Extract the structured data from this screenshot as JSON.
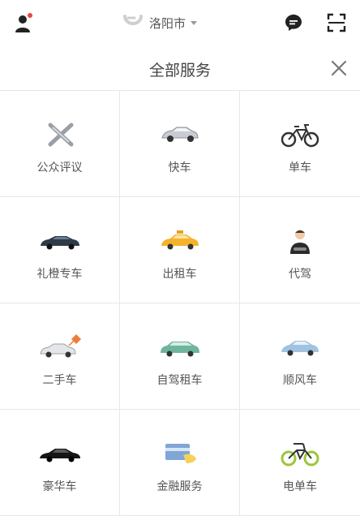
{
  "top_bar": {
    "city": "洛阳市",
    "icons": [
      "user-icon",
      "didi-logo-icon",
      "chat-icon",
      "scan-icon"
    ],
    "notification_color": "#e8473b"
  },
  "header": {
    "title": "全部服务",
    "close_icon": "close-icon"
  },
  "services": [
    {
      "label": "公众评议",
      "icon": "review-icon"
    },
    {
      "label": "快车",
      "icon": "car-icon"
    },
    {
      "label": "单车",
      "icon": "bicycle-icon"
    },
    {
      "label": "礼橙专车",
      "icon": "premier-car-icon"
    },
    {
      "label": "出租车",
      "icon": "taxi-icon"
    },
    {
      "label": "代驾",
      "icon": "driver-icon"
    },
    {
      "label": "二手车",
      "icon": "used-car-icon"
    },
    {
      "label": "自驾租车",
      "icon": "rental-car-icon"
    },
    {
      "label": "顺风车",
      "icon": "carpool-car-icon"
    },
    {
      "label": "豪华车",
      "icon": "luxury-car-icon"
    },
    {
      "label": "金融服务",
      "icon": "card-icon"
    },
    {
      "label": "电单车",
      "icon": "ebike-icon"
    }
  ]
}
